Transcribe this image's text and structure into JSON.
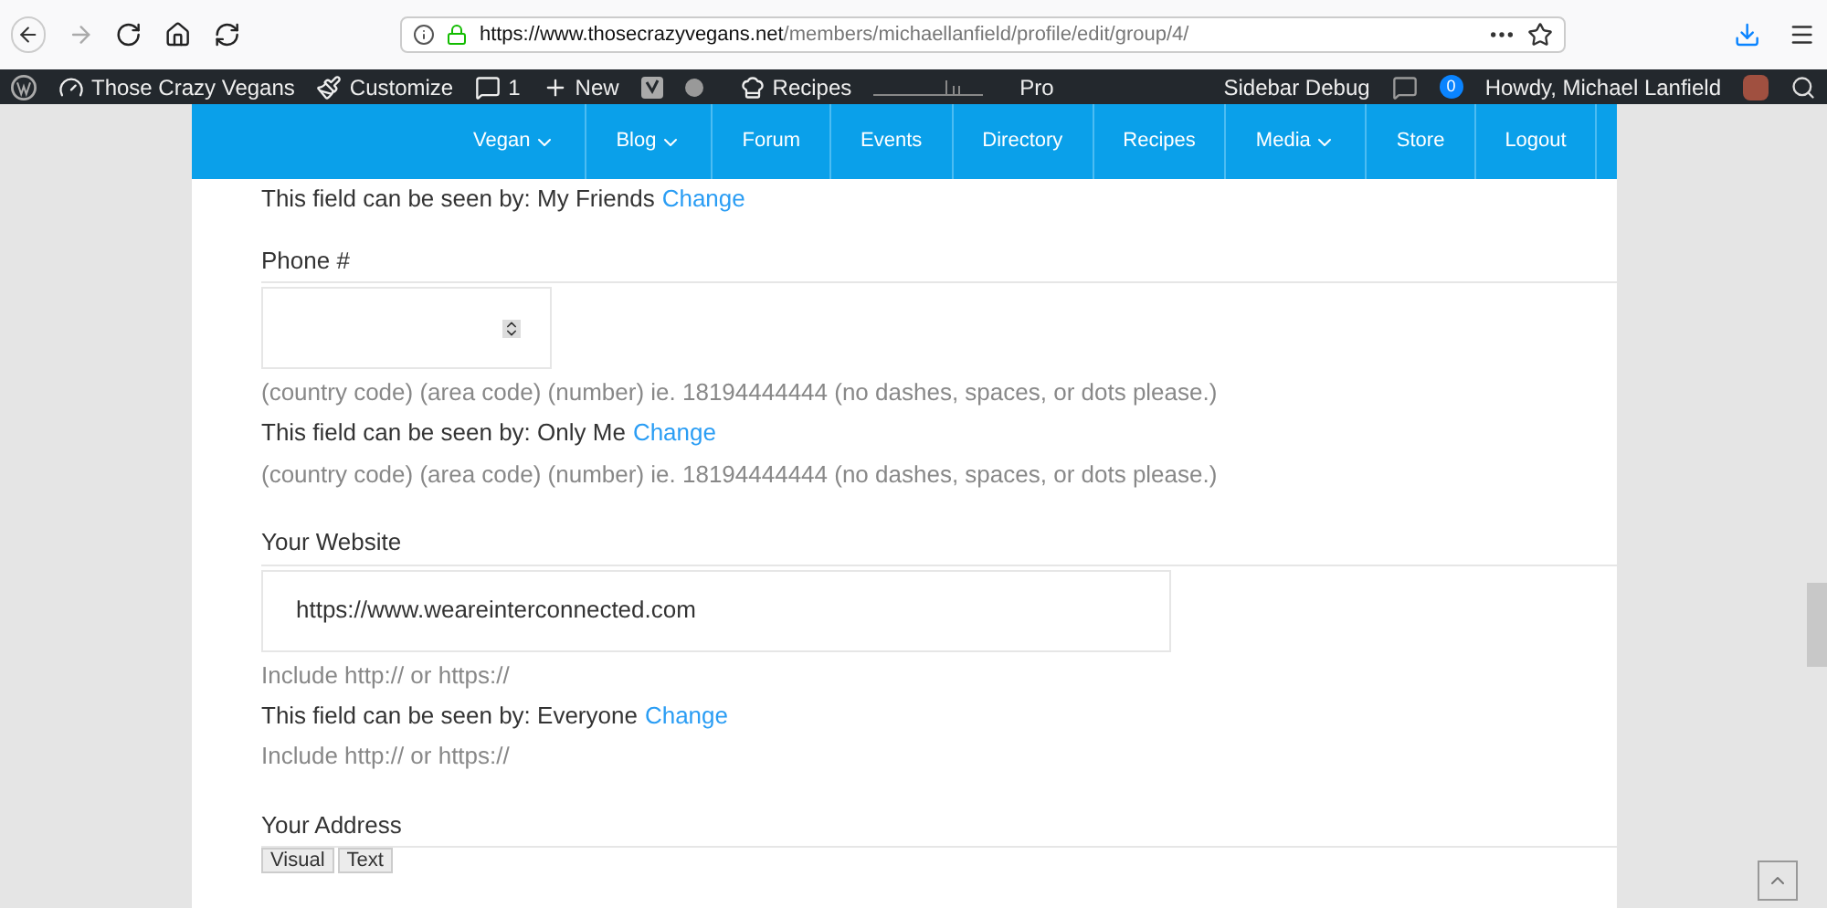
{
  "browser": {
    "url_host": "https://www.thosecrazyvegans.net",
    "url_path": "/members/michaellanfield/profile/edit/group/4/"
  },
  "admin_bar": {
    "site": "Those Crazy Vegans",
    "customize": "Customize",
    "comments": "1",
    "new": "New",
    "recipes": "Recipes",
    "pro": "Pro",
    "sidebar_debug": "Sidebar Debug",
    "notifications": "0",
    "greeting": "Howdy, Michael Lanfield"
  },
  "nav": [
    {
      "label": "Vegan",
      "has_dropdown": true
    },
    {
      "label": "Blog",
      "has_dropdown": true
    },
    {
      "label": "Forum",
      "has_dropdown": false
    },
    {
      "label": "Events",
      "has_dropdown": false
    },
    {
      "label": "Directory",
      "has_dropdown": false
    },
    {
      "label": "Recipes",
      "has_dropdown": false
    },
    {
      "label": "Media",
      "has_dropdown": true
    },
    {
      "label": "Store",
      "has_dropdown": false
    },
    {
      "label": "Logout",
      "has_dropdown": false
    }
  ],
  "top_visibility": {
    "text": "This field can be seen by: My Friends",
    "link": "Change"
  },
  "fields": [
    {
      "kind": "number",
      "label": "Phone #",
      "hint": "(country code) (area code) (number) ie. 18194444444 (no dashes, spaces, or dots please.)",
      "visibility": "This field can be seen by: Only Me",
      "link": "Change",
      "hint_after": "(country code) (area code) (number) ie. 18194444444 (no dashes, spaces, or dots please.)"
    },
    {
      "kind": "text",
      "label": "Your Website",
      "value": "https://www.weareinterconnected.com",
      "hint": "Include http:// or https://",
      "visibility": "This field can be seen by: Everyone",
      "link": "Change",
      "hint_after": "Include http:// or https://"
    },
    {
      "kind": "editor",
      "label": "Your Address",
      "tabs": [
        "Visual",
        "Text"
      ]
    }
  ]
}
